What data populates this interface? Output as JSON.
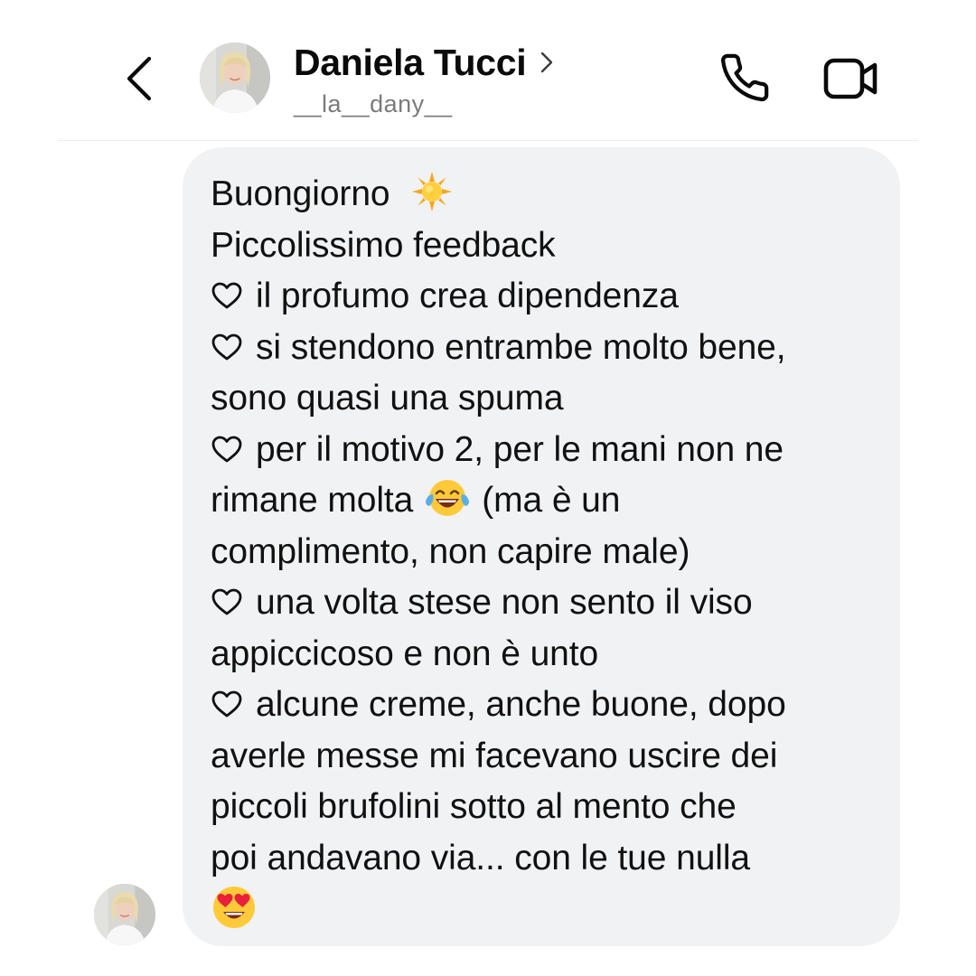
{
  "header": {
    "contact_name": "Daniela Tucci",
    "username": "__la__dany__",
    "back_icon": "chevron-left-icon",
    "call_icon": "phone-icon",
    "video_icon": "video-camera-icon"
  },
  "message": {
    "lines": [
      "Buongiorno",
      "Piccolissimo feedback",
      "il profumo crea dipendenza",
      "si stendono entrambe molto bene,",
      "sono quasi una spuma",
      "per il motivo 2, per le mani non ne",
      "rimane molta",
      "(ma è un",
      "complimento, non capire male)",
      "una volta stese non sento il viso",
      "appiccicoso e non è unto",
      "alcune creme, anche buone, dopo",
      "averle messe mi facevano uscire dei",
      "piccoli brufolini sotto al mento che",
      "poi andavano via... con le tue nulla"
    ],
    "emojis": [
      "sun",
      "face-with-tears-of-joy",
      "smiling-face-with-heart-eyes"
    ],
    "bullet_icon": "heart-outline-icon"
  },
  "colors": {
    "bubble": "#f1f2f4",
    "text": "#111111",
    "username": "#7b7b7b",
    "divider": "#ececec"
  }
}
